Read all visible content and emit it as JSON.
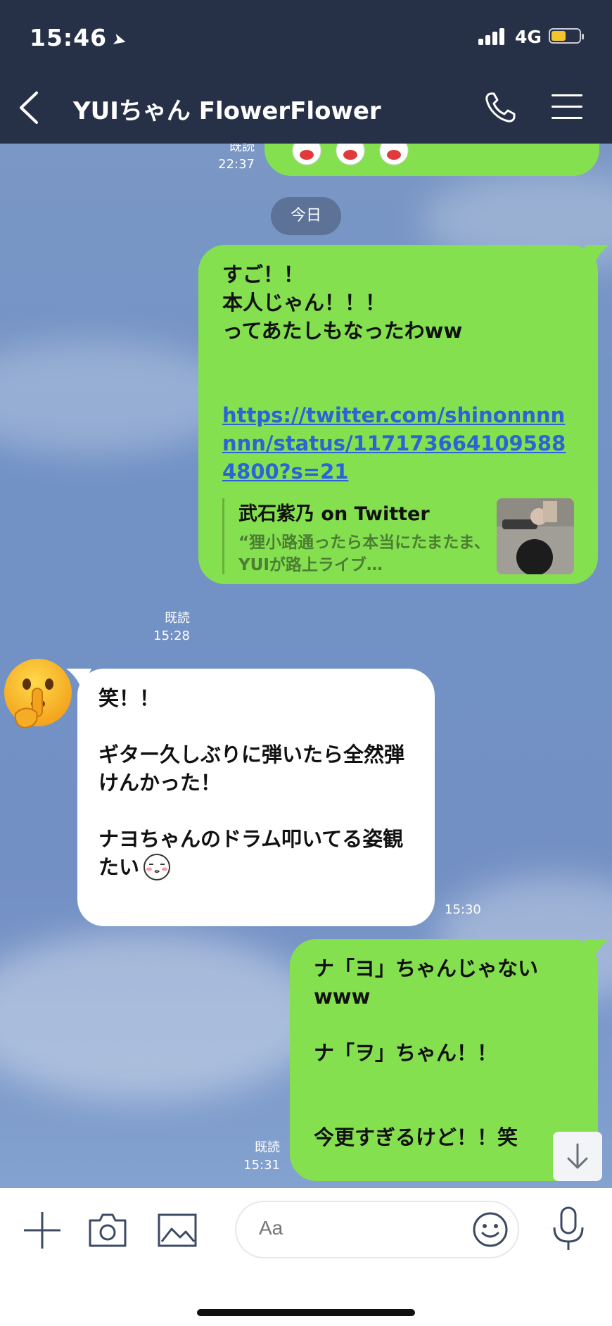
{
  "status_bar": {
    "time": "15:46",
    "network": "4G"
  },
  "header": {
    "title": "YUIちゃん  FlowerFlower"
  },
  "messages": {
    "prev": {
      "read": "既読",
      "time": "22:37"
    },
    "date_divider": "今日",
    "m1": {
      "text": "すご！！\n本人じゃん！！！\nってあたしもなったわww",
      "link": "https://twitter.com/shinonnnnnnn/status/1171736641095884800?s=21",
      "preview_title": "武石紫乃 on Twitter",
      "preview_desc": "“狸小路通ったら本当にたまたま、YUIが路上ライブ…",
      "read": "既読",
      "time": "15:28"
    },
    "m2": {
      "text": "笑！！\n\nギター久しぶりに弾いたら全然弾けんかった！\n\nナヨちゃんのドラム叩いてる姿観たい",
      "time": "15:30"
    },
    "m3": {
      "text": "ナ「ヨ」ちゃんじゃない\nwww\n\nナ「ヲ」ちゃん！！\n\n\n今更すぎるけど！！笑",
      "read": "既読",
      "time": "15:31"
    }
  },
  "input": {
    "placeholder": "Aa"
  },
  "icons": [
    "back-icon",
    "phone-icon",
    "menu-icon",
    "plus-icon",
    "camera-icon",
    "image-icon",
    "emoji-icon",
    "mic-icon",
    "scroll-down-icon"
  ]
}
